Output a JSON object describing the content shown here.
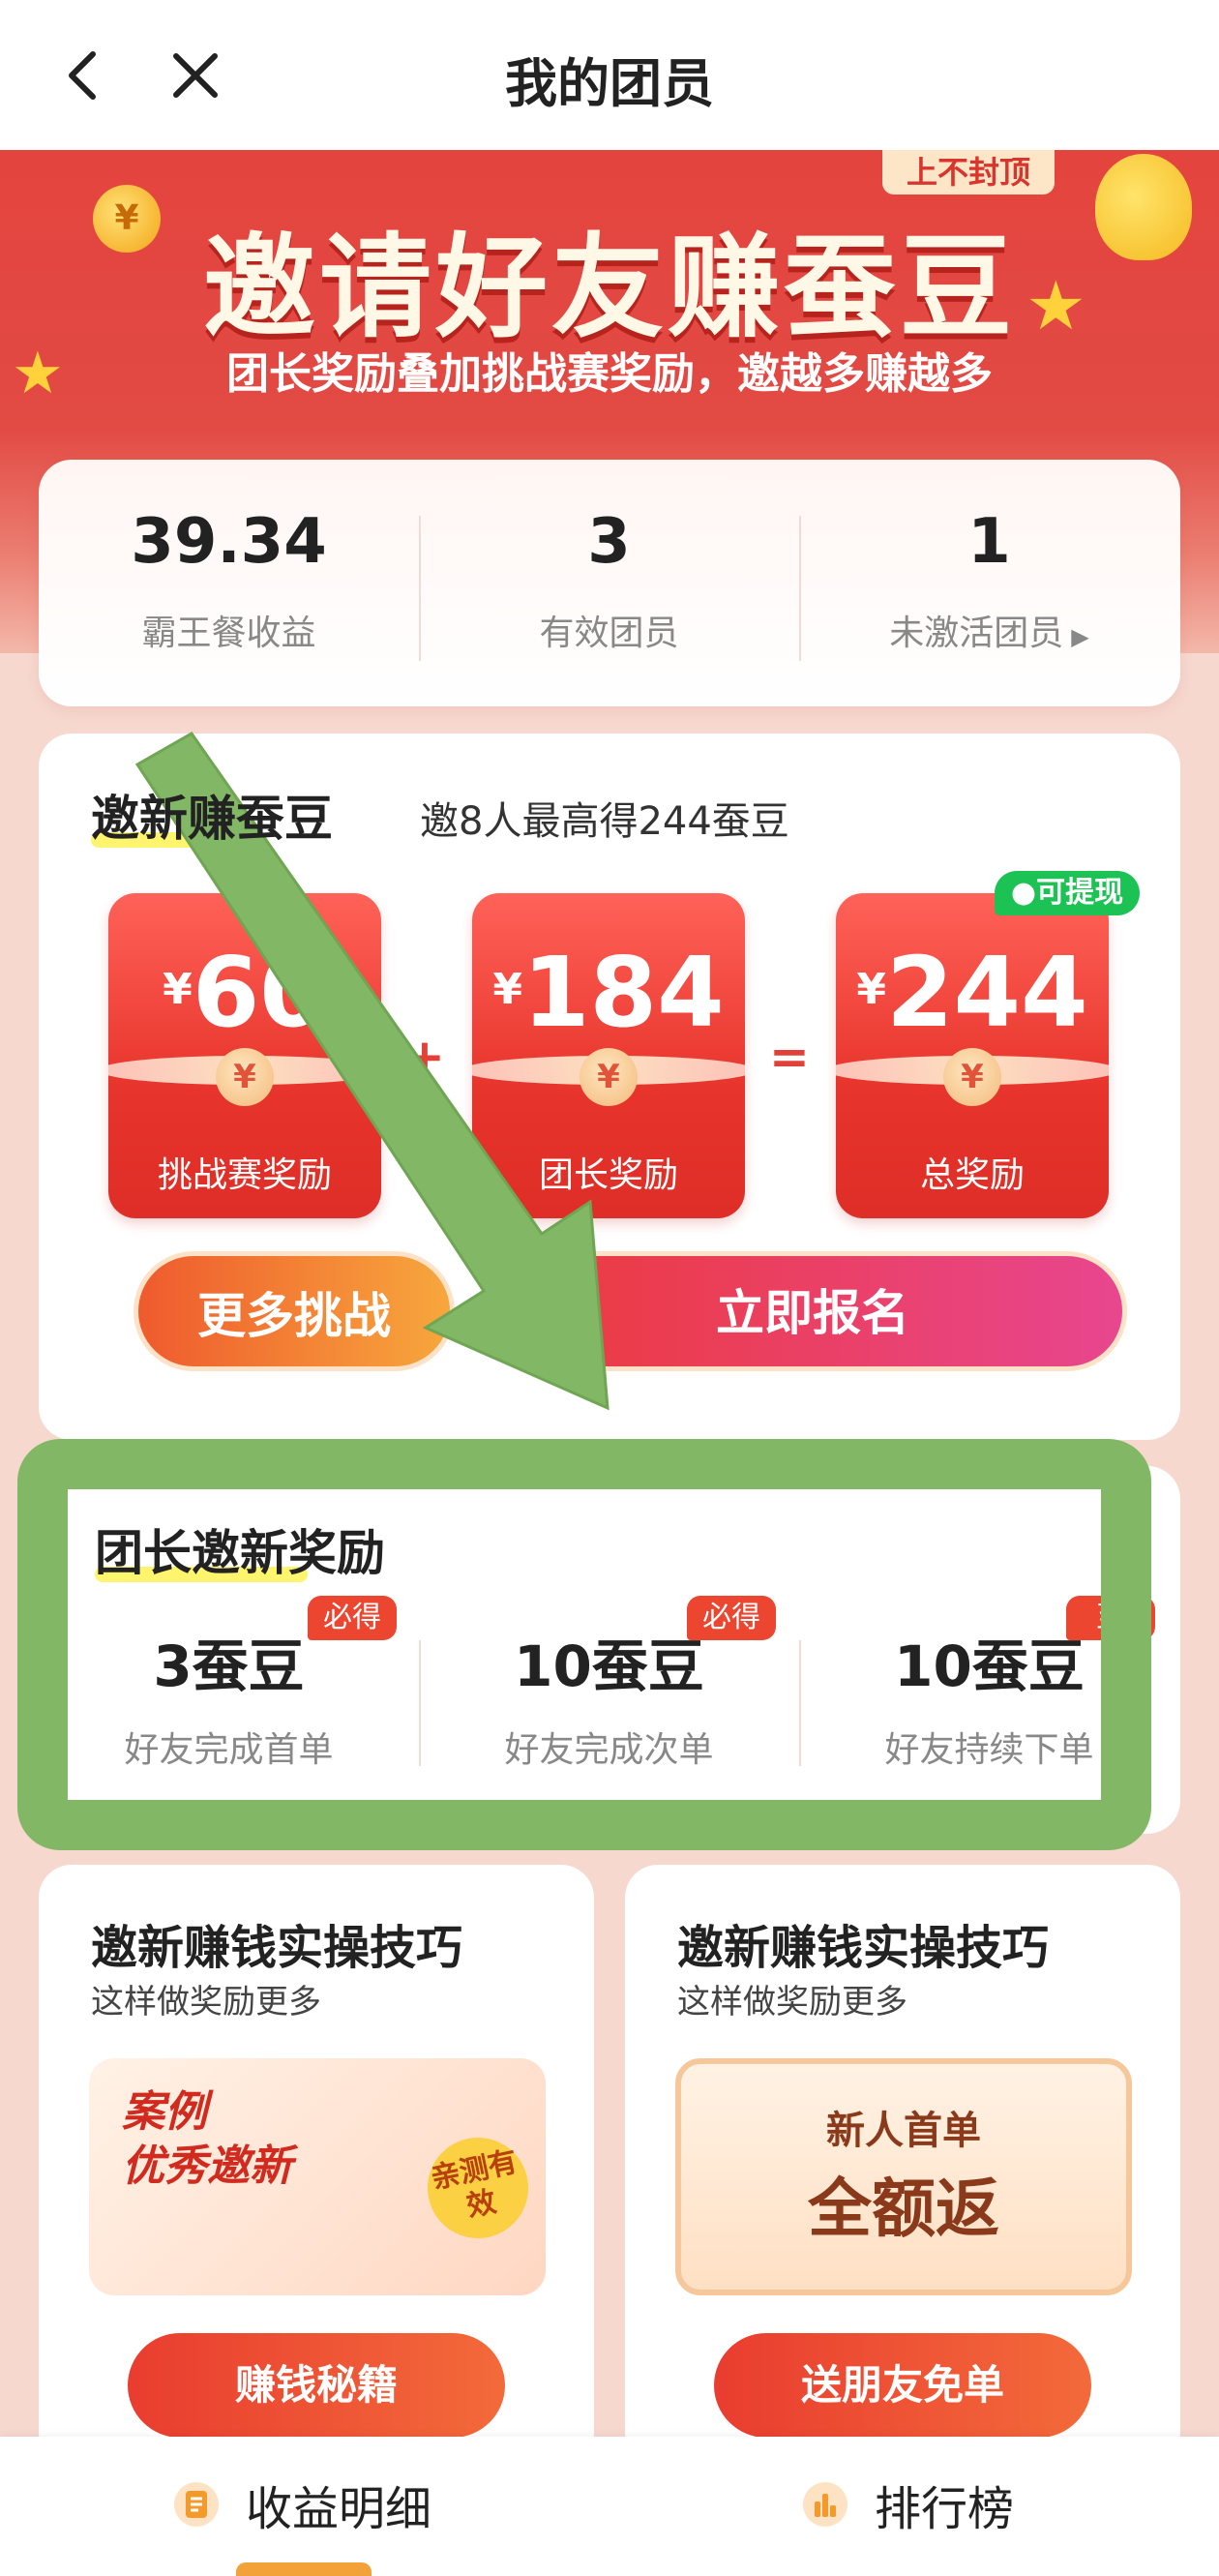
{
  "nav": {
    "title": "我的团员"
  },
  "banner": {
    "title": "邀请好友赚蚕豆",
    "subtitle": "团长奖励叠加挑战赛奖励，邀越多赚越多",
    "tag": "上不封顶"
  },
  "stats": [
    {
      "value": "39.34",
      "label": "霸王餐收益"
    },
    {
      "value": "3",
      "label": "有效团员"
    },
    {
      "value": "1",
      "label": "未激活团员"
    }
  ],
  "invite": {
    "title": "邀新赚蚕豆",
    "subtitle": "邀8人最高得244蚕豆",
    "currency": "¥",
    "coin_symbol": "¥",
    "packets": [
      {
        "amount": "60",
        "caption": "挑战赛奖励"
      },
      {
        "amount": "184",
        "caption": "团长奖励"
      },
      {
        "amount": "244",
        "caption": "总奖励"
      }
    ],
    "plus": "+",
    "equals": "=",
    "withdraw_badge": "可提现",
    "more_button": "更多挑战",
    "join_button": "立即报名"
  },
  "leader": {
    "title": "团长邀新奖励",
    "rewards": [
      {
        "value": "3蚕豆",
        "desc": "好友完成首单",
        "tag": "必得"
      },
      {
        "value": "10蚕豆",
        "desc": "好友完成次单",
        "tag": "必得"
      },
      {
        "value": "10蚕豆",
        "desc": "好友持续下单",
        "tag": "至"
      }
    ]
  },
  "tips": [
    {
      "title": "邀新赚钱实操技巧",
      "subtitle": "这样做奖励更多",
      "button": "赚钱秘籍",
      "image_line1": "案例",
      "image_line2": "优秀邀新",
      "image_seal": "亲测有效"
    },
    {
      "title": "邀新赚钱实操技巧",
      "subtitle": "这样做奖励更多",
      "button": "送朋友免单",
      "image_line1": "新人首单",
      "image_line2": "全额返"
    }
  ],
  "bottom_tabs": [
    {
      "label": "收益明细",
      "icon": "document-icon"
    },
    {
      "label": "排行榜",
      "icon": "bar-chart-icon"
    }
  ],
  "colors": {
    "brand_red": "#e4443e",
    "annotation_green": "#82b865",
    "withdraw_green": "#1dc254"
  }
}
